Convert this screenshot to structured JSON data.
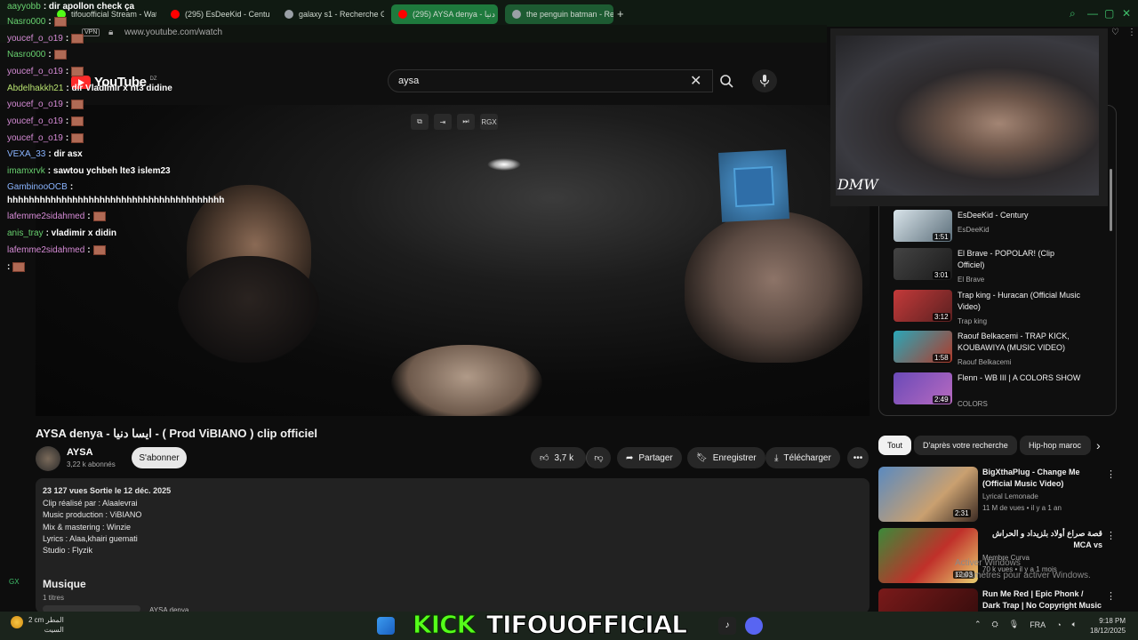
{
  "browser": {
    "tabs": [
      {
        "label": "tifouofficial Stream - Watc",
        "color": "#53fc18"
      },
      {
        "label": "(295) EsDeeKid - Century",
        "color": "#ff0000"
      },
      {
        "label": "galaxy s1 - Recherche Go",
        "color": "#9aa0a6"
      },
      {
        "label": "(295) AYSA denya - دنيا",
        "color": "#ff0000"
      },
      {
        "label": "the penguin batman - Rec",
        "color": "#9aa0a6"
      }
    ],
    "new_tab": "+",
    "vpn": "VPN",
    "url": "www.youtube.com/watch",
    "accent": "#1e7a3d"
  },
  "youtube": {
    "logo": "YouTube",
    "country": "DZ",
    "search_value": "aysa"
  },
  "video_controls": [
    "RGX"
  ],
  "video": {
    "title": "AYSA denya - ايسا دنيا - ( Prod ViBIANO ) clip officiel",
    "channel": "AYSA",
    "subscribers": "3,22 k abonnés",
    "subscribe": "S'abonner",
    "likes": "3,7 k",
    "share": "Partager",
    "save": "Enregistrer",
    "download": "Télécharger",
    "description": {
      "stats": "23 127 vues  Sortie le 12 déc. 2025",
      "lines": [
        "Clip réalisé par : Alaalevrai",
        "Music production : ViBIANO",
        "Mix & mastering : Winzie",
        "Lyrics : Alaa,khairi guemati",
        "Studio : Flyzik"
      ],
      "music_heading": "Musique",
      "music_count": "1 titres",
      "music_item": "AYSA denya"
    }
  },
  "chat": [
    {
      "user": "aayyobb",
      "text": ": dir apollon check ça"
    },
    {
      "user": "Nasro000",
      "text": ":"
    },
    {
      "user": "youcef_o_o19",
      "text": ":"
    },
    {
      "user": "Nasro000",
      "text": ":"
    },
    {
      "user": "youcef_o_o19",
      "text": ":"
    },
    {
      "user": "Abdelhakkh21",
      "text": ": dir Vladimir x nt3 didine"
    },
    {
      "user": "youcef_o_o19",
      "text": ":"
    },
    {
      "user": "youcef_o_o19",
      "text": ":"
    },
    {
      "user": "youcef_o_o19",
      "text": ":"
    },
    {
      "user": "VEXA_33",
      "text": ": dir asx"
    },
    {
      "user": "imamxrvk",
      "text": ": sawtou ychbeh lte3 islem23"
    },
    {
      "user": "GambinooOCB",
      "text": ":"
    },
    {
      "user": "",
      "text": "hhhhhhhhhhhhhhhhhhhhhhhhhhhhhhhhhhhhhhhh"
    },
    {
      "user": "lafemme2sidahmed",
      "text": ":"
    },
    {
      "user": "anis_tray",
      "text": ": vladimir x didin"
    },
    {
      "user": "lafemme2sidahmed",
      "text": ":"
    },
    {
      "user": "",
      "text": ":"
    }
  ],
  "webcam": {
    "overlay_text": "DMW"
  },
  "playlist": [
    {
      "title": "EsDeeKid - Century",
      "channel": "EsDeeKid",
      "duration": "1:51"
    },
    {
      "title": "El Brave - POPOLAR! (Clip Officiel)",
      "channel": "El Brave",
      "duration": "3:01"
    },
    {
      "title": "Trap king - Huracan (Official Music Video)",
      "channel": "Trap king",
      "duration": "3:12"
    },
    {
      "title": "Raouf Belkacemi - TRAP KICK, KOUBAWIYA (MUSIC VIDEO)",
      "channel": "Raouf Belkacemi",
      "duration": "1:58"
    },
    {
      "title": "Flenn - WB III | A COLORS SHOW",
      "channel": "COLORS",
      "duration": "2:49"
    }
  ],
  "chips": [
    "Tout",
    "D'après votre recherche",
    "Hip-hop maroc"
  ],
  "recommendations": [
    {
      "title": "BigXthaPlug - Change Me (Official Music Video)",
      "channel": "Lyrical Lemonade",
      "meta": "11 M de vues • il y a 1 an",
      "duration": "2:31"
    },
    {
      "title": "قصة صراع أولاد بلزيداد و الحراش MCA vs",
      "channel": "Membre Curva",
      "meta": "70 k vues • il y a 1 mois",
      "duration": "12:03"
    },
    {
      "title": "Run Me Red | Epic Phonk / Dark Trap | No Copyright Music",
      "channel": "",
      "meta": "",
      "duration": ""
    }
  ],
  "windows_activation": {
    "line1": "Activer Windows",
    "line2": "Paramètres pour activer Windows."
  },
  "taskbar": {
    "weather_temp": "2 cm",
    "weather_label": "المطر",
    "weather_sub": "السيت",
    "stream_brand": "KICK",
    "stream_name": "TIFOUOFFICIAL",
    "lang": "FRA",
    "time": "9:18 PM",
    "date": "18/12/2025",
    "gx": "GX"
  }
}
